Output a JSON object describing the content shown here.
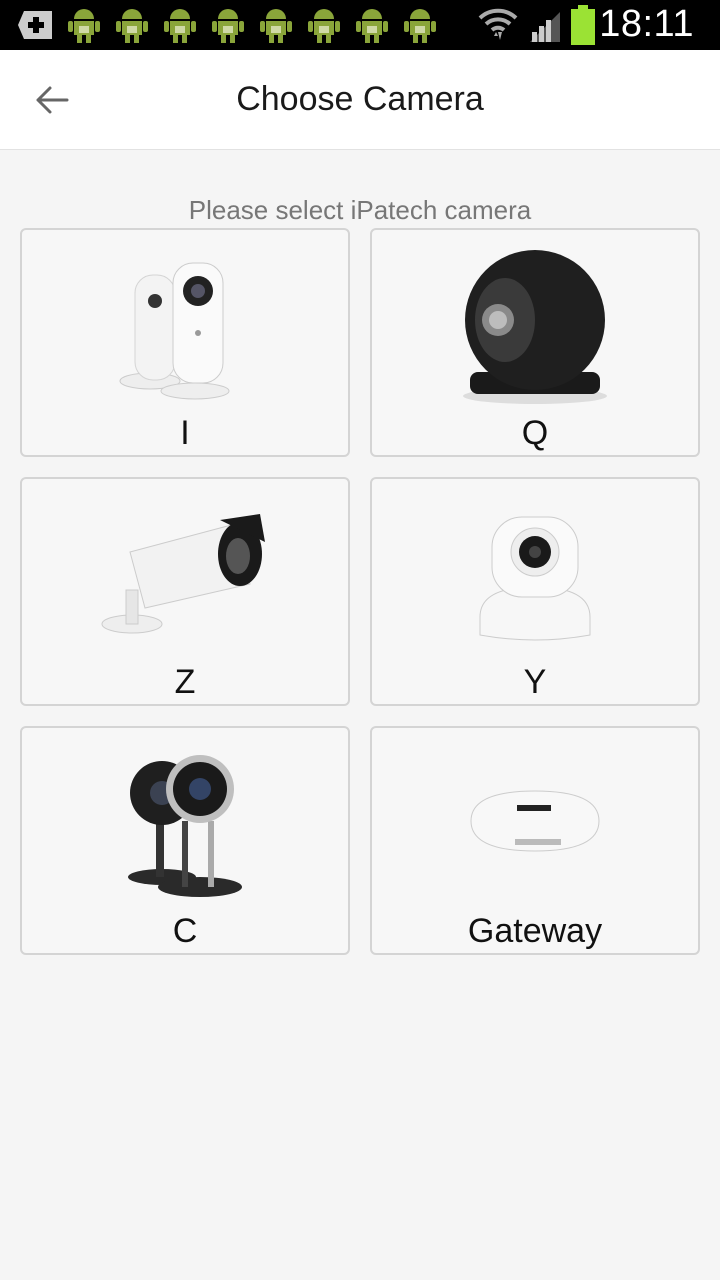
{
  "status_bar": {
    "time": "18:11",
    "notification_icons": [
      "add-notification-icon",
      "android-icon",
      "android-icon",
      "android-icon",
      "android-icon",
      "android-icon",
      "android-icon",
      "android-icon",
      "android-icon"
    ]
  },
  "header": {
    "title": "Choose Camera"
  },
  "main": {
    "subtitle": "Please select iPatech camera",
    "cameras": [
      {
        "label": "I"
      },
      {
        "label": "Q"
      },
      {
        "label": "Z"
      },
      {
        "label": "Y"
      },
      {
        "label": "C"
      },
      {
        "label": "Gateway"
      }
    ]
  },
  "colors": {
    "background": "#f5f5f5",
    "header_bg": "#ffffff",
    "tile_border": "#d4d4d4",
    "battery": "#9be234"
  }
}
